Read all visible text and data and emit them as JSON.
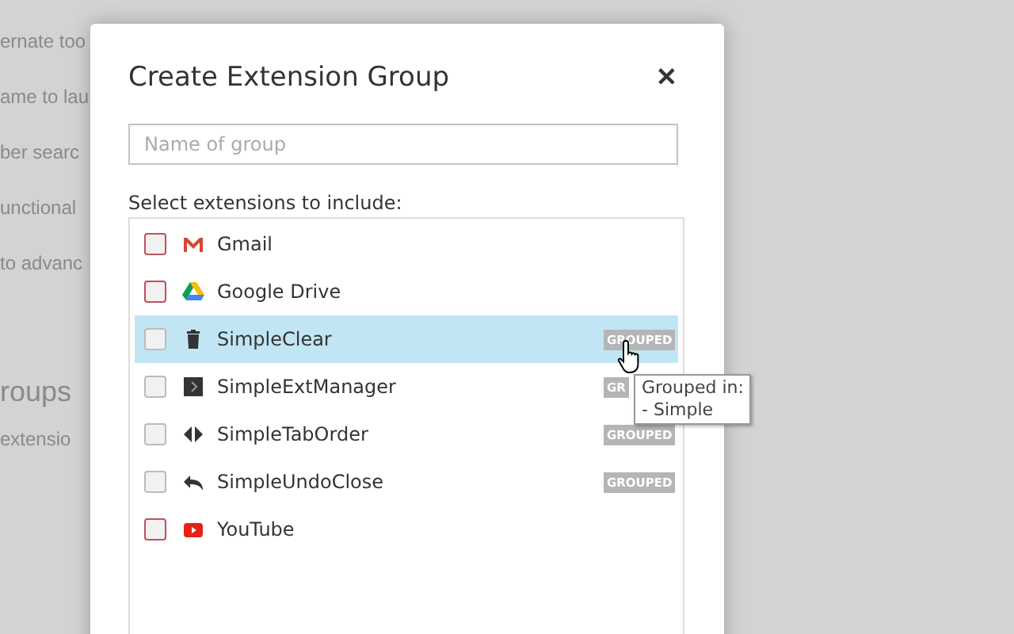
{
  "background_page": {
    "texts": [
      {
        "text": "ernate too",
        "kind": "line"
      },
      {
        "text": "ame to lau",
        "kind": "line"
      },
      {
        "text": "ber searc",
        "kind": "line"
      },
      {
        "text": "unctional",
        "kind": "line"
      },
      {
        "text": "to advanc",
        "kind": "line"
      },
      {
        "text": "roups",
        "kind": "heading"
      },
      {
        "text": "extensio",
        "kind": "line"
      }
    ]
  },
  "dialog": {
    "title": "Create Extension Group",
    "close": "✕",
    "name_field": {
      "placeholder": "Name of group"
    },
    "list_label": "Select extensions to include:",
    "extensions": [
      {
        "name": "Gmail",
        "kind": "mail",
        "checked": false,
        "grouped": false,
        "hovered": false
      },
      {
        "name": "Google Drive",
        "kind": "drive",
        "checked": false,
        "grouped": false,
        "hovered": false
      },
      {
        "name": "SimpleClear",
        "kind": "trash",
        "checked": false,
        "grouped": true,
        "badge": "GROUPED",
        "hovered": true
      },
      {
        "name": "SimpleExtManager",
        "kind": "manager",
        "checked": false,
        "grouped": true,
        "badge": "GR",
        "hovered": false
      },
      {
        "name": "SimpleTabOrder",
        "kind": "taborder",
        "checked": false,
        "grouped": true,
        "badge": "GROUPED",
        "hovered": false
      },
      {
        "name": "SimpleUndoClose",
        "kind": "undo",
        "checked": false,
        "grouped": true,
        "badge": "GROUPED",
        "hovered": false
      },
      {
        "name": "YouTube",
        "kind": "video",
        "checked": false,
        "grouped": false,
        "hovered": false
      }
    ],
    "tooltip": {
      "lines": [
        "Grouped in:",
        "- Simple"
      ]
    }
  }
}
